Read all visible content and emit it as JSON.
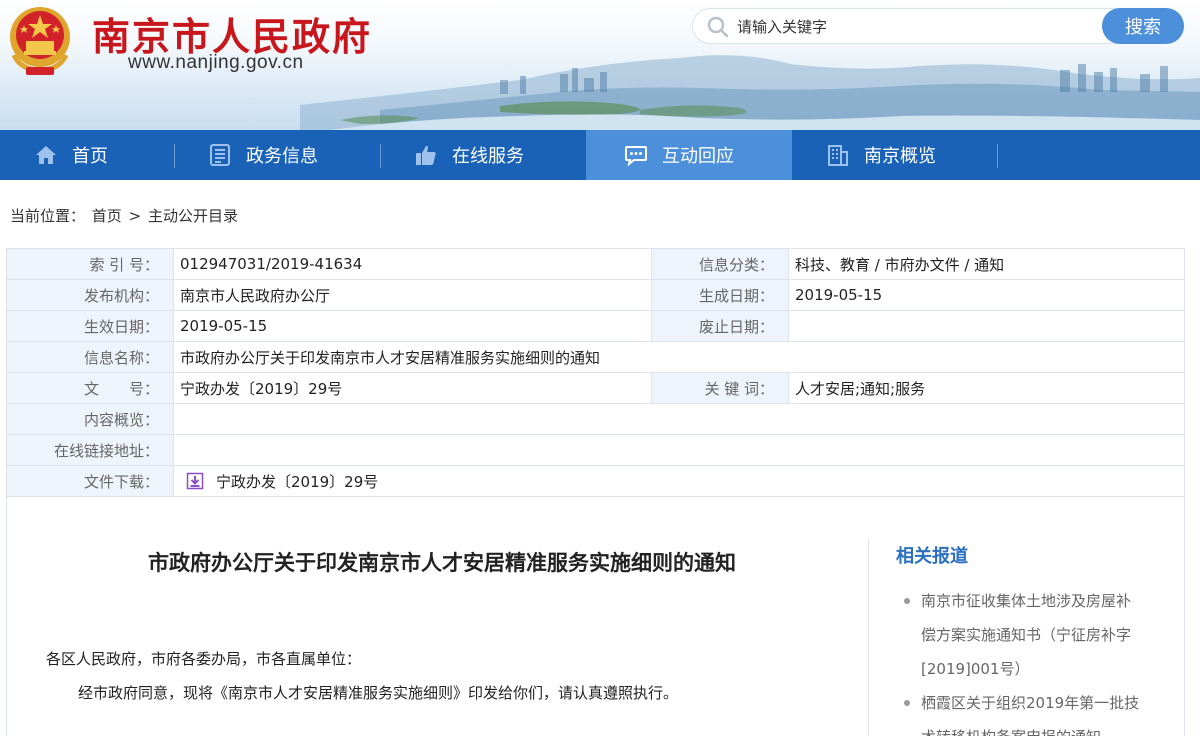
{
  "header": {
    "site_title": "南京市人民政府",
    "site_url": "www.nanjing.gov.cn",
    "search_placeholder": "请输入关键字",
    "search_button": "搜索",
    "brand_red": "#c8161d",
    "accent_blue": "#4c8fda"
  },
  "nav": {
    "items": [
      {
        "label": "首页",
        "icon": "home-icon"
      },
      {
        "label": "政务信息",
        "icon": "document-icon"
      },
      {
        "label": "在线服务",
        "icon": "thumbs-up-icon"
      },
      {
        "label": "互动回应",
        "icon": "chat-icon",
        "active": true
      },
      {
        "label": "南京概览",
        "icon": "building-icon"
      }
    ],
    "bar_color": "#1a62b8"
  },
  "breadcrumb": {
    "prefix": "当前位置：",
    "home": "首页",
    "separator": ">",
    "current": "主动公开目录"
  },
  "info": {
    "index_label": "索 引 号：",
    "index_value": "012947031/2019-41634",
    "category_label": "信息分类：",
    "category_value": "科技、教育 / 市府办文件 / 通知",
    "publisher_label": "发布机构：",
    "publisher_value": "南京市人民政府办公厅",
    "created_label": "生成日期：",
    "created_value": "2019-05-15",
    "effective_label": "生效日期：",
    "effective_value": "2019-05-15",
    "expire_label": "废止日期：",
    "expire_value": "",
    "name_label": "信息名称：",
    "name_value": "市政府办公厅关于印发南京市人才安居精准服务实施细则的通知",
    "docno_label": "文　　号：",
    "docno_value": "宁政办发〔2019〕29号",
    "keywords_label": "关 键 词：",
    "keywords_value": "人才安居;通知;服务",
    "summary_label": "内容概览：",
    "summary_value": "",
    "link_label": "在线链接地址：",
    "link_value": "",
    "download_label": "文件下载：",
    "download_value": "宁政办发〔2019〕29号"
  },
  "document": {
    "title": "市政府办公厅关于印发南京市人才安居精准服务实施细则的通知",
    "salutation": "各区人民政府，市府各委办局，市各直属单位：",
    "paragraph1": "经市政府同意，现将《南京市人才安居精准服务实施细则》印发给你们，请认真遵照执行。"
  },
  "related": {
    "title": "相关报道",
    "items": [
      {
        "line1": "南京市征收集体土地涉及房屋补",
        "line2": "偿方案实施通知书（宁征房补字",
        "line3": "[2019]001号）"
      },
      {
        "line1": "栖霞区关于组织2019年第一批技",
        "line2": "术转移机构备案申报的通知"
      }
    ]
  }
}
